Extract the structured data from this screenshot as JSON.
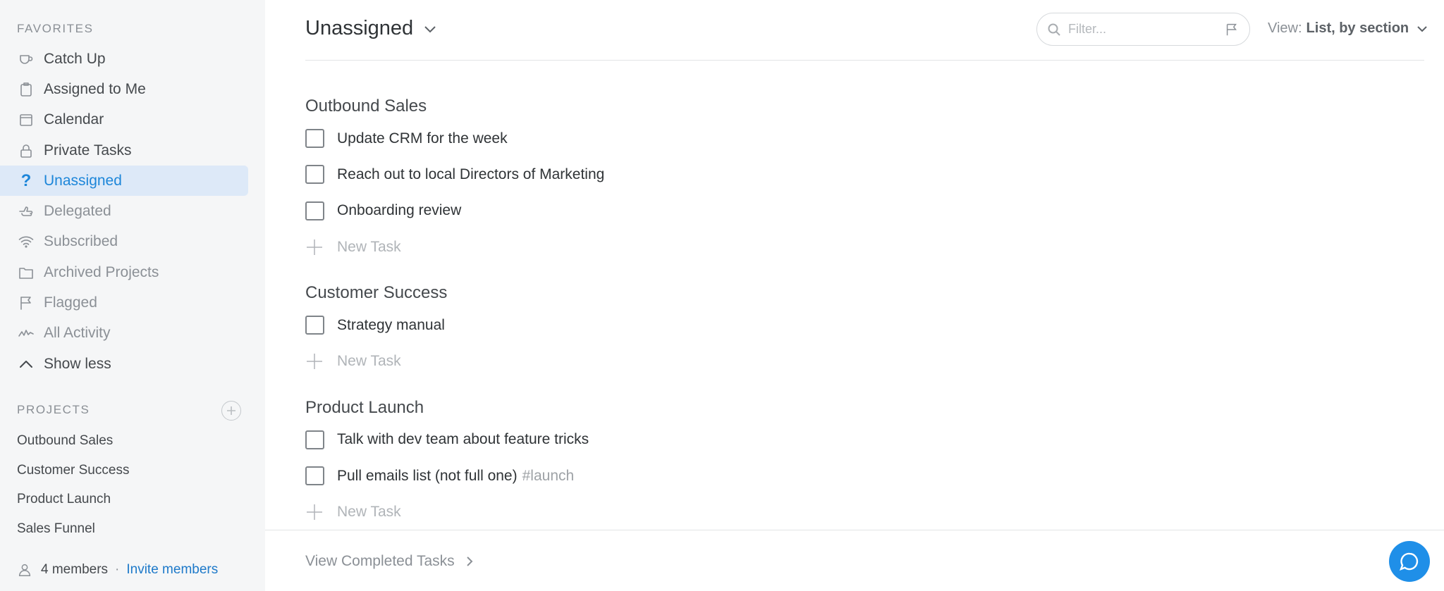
{
  "sidebar": {
    "favorites_heading": "FAVORITES",
    "favorites": [
      {
        "label": "Catch Up",
        "icon": "cup-icon"
      },
      {
        "label": "Assigned to Me",
        "icon": "clipboard-icon"
      },
      {
        "label": "Calendar",
        "icon": "calendar-icon"
      },
      {
        "label": "Private Tasks",
        "icon": "lock-icon"
      },
      {
        "label": "Unassigned",
        "icon": "question-icon",
        "active": true
      },
      {
        "label": "Delegated",
        "icon": "thumb-icon"
      },
      {
        "label": "Subscribed",
        "icon": "wifi-icon"
      },
      {
        "label": "Archived Projects",
        "icon": "folder-icon"
      },
      {
        "label": "Flagged",
        "icon": "flag-icon"
      },
      {
        "label": "All Activity",
        "icon": "activity-icon"
      },
      {
        "label": "Show less",
        "icon": "chevron-up-icon"
      }
    ],
    "projects_heading": "PROJECTS",
    "projects": [
      "Outbound Sales",
      "Customer Success",
      "Product Launch",
      "Sales Funnel"
    ],
    "members_label": "4 members",
    "separator": "·",
    "invite_label": "Invite members"
  },
  "header": {
    "title": "Unassigned",
    "filter_placeholder": "Filter...",
    "view_prefix": "View:",
    "view_value": "List, by section"
  },
  "groups": [
    {
      "title": "Outbound Sales",
      "tasks": [
        {
          "name": "Update CRM for the week"
        },
        {
          "name": "Reach out to local Directors of Marketing"
        },
        {
          "name": "Onboarding review"
        }
      ],
      "new_task_label": "New Task"
    },
    {
      "title": "Customer Success",
      "tasks": [
        {
          "name": "Strategy manual"
        }
      ],
      "new_task_label": "New Task"
    },
    {
      "title": "Product Launch",
      "tasks": [
        {
          "name": "Talk with dev team about feature tricks"
        },
        {
          "name": "Pull emails list (not full one)",
          "tag": "#launch"
        }
      ],
      "new_task_label": "New Task"
    }
  ],
  "footer": {
    "view_completed_label": "View Completed Tasks"
  },
  "colors": {
    "accent": "#1d86d9",
    "active_bg": "#dde9f8",
    "sidebar_bg": "#f5f6f7",
    "chat_button": "#1f8fe8"
  }
}
